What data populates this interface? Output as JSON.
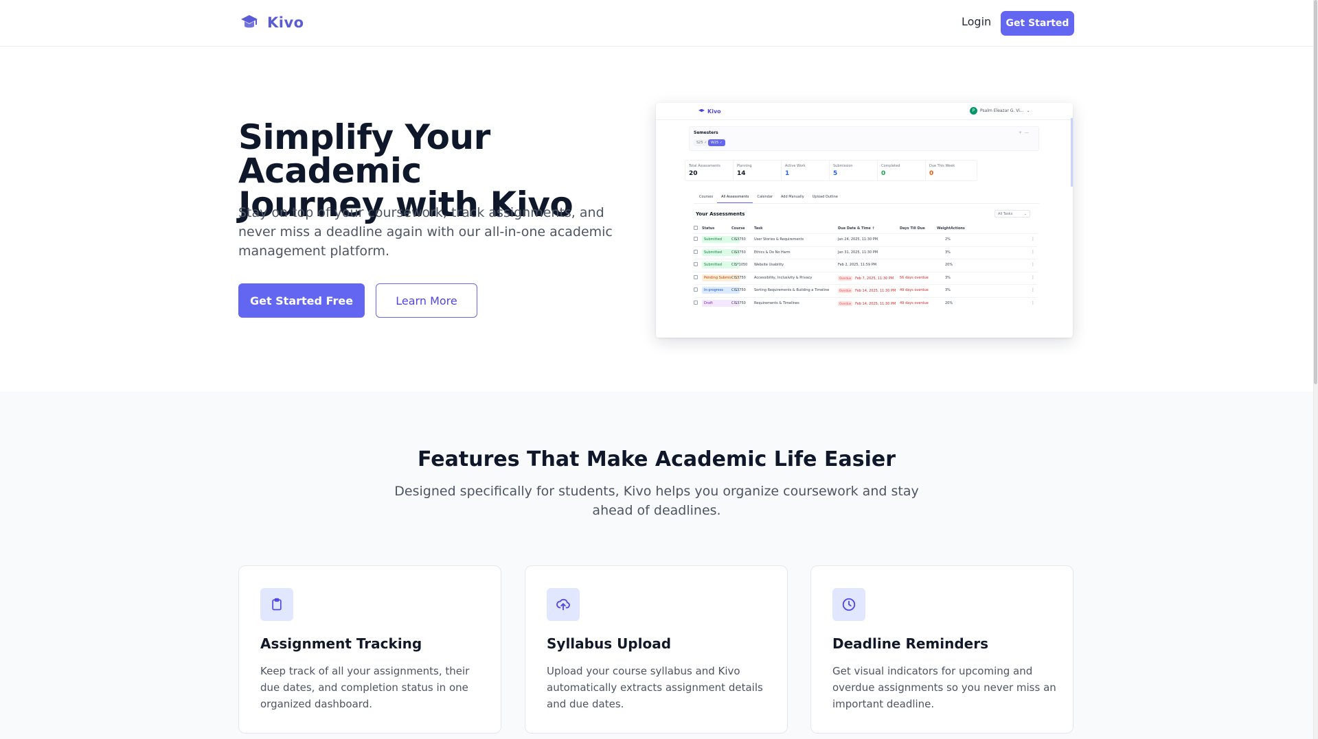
{
  "header": {
    "brand": "Kivo",
    "login": "Login",
    "cta": "Get Started"
  },
  "hero": {
    "title_line1": "Simplify Your Academic",
    "title_line2": "Journey with Kivo",
    "subtitle": "Stay on top of your coursework, track assignments, and never miss a deadline again with our all-in-one academic management platform.",
    "primary_button": "Get Started Free",
    "secondary_button": "Learn More"
  },
  "preview": {
    "brand": "Kivo",
    "user_initial": "P",
    "user_name": "Psalm Eleazar G. Vi...",
    "semesters_label": "Semesters",
    "semester_pills": [
      "S25 ✓",
      "W25 ✓"
    ],
    "stats": [
      {
        "label": "Total Assessments",
        "value": "20",
        "color": "#111827"
      },
      {
        "label": "Planning",
        "value": "14",
        "color": "#111827"
      },
      {
        "label": "Active Work",
        "value": "1",
        "color": "#2563eb"
      },
      {
        "label": "Submission",
        "value": "5",
        "color": "#2563eb"
      },
      {
        "label": "Completed",
        "value": "0",
        "color": "#16a34a"
      },
      {
        "label": "Due This Week",
        "value": "0",
        "color": "#ea580c"
      }
    ],
    "tabs": [
      "Courses",
      "All Assessments",
      "Calendar",
      "Add Manually",
      "Upload Outline"
    ],
    "panel_title": "Your Assessments",
    "filter": "All Tasks",
    "columns": [
      "Status",
      "Course",
      "Task",
      "Due Date & Time ↑",
      "Days Till Due",
      "Weight",
      "Actions"
    ],
    "rows": [
      {
        "status": "Submitted",
        "status_class": "st-submitted",
        "course": "CIS3750",
        "task": "User Stories & Requirements",
        "due": "Jan 24, 2025, 11:30 PM",
        "days": "",
        "weight": "2%",
        "overdue": false
      },
      {
        "status": "Submitted",
        "status_class": "st-submitted",
        "course": "CIS3750",
        "task": "Ethics & Do No Harm",
        "due": "Jan 31, 2025, 11:30 PM",
        "days": "",
        "weight": "3%",
        "overdue": false
      },
      {
        "status": "Submitted",
        "status_class": "st-submitted",
        "course": "CIS*1050",
        "task": "Website Usability",
        "due": "Feb 2, 2025, 11:59 PM",
        "days": "",
        "weight": "20%",
        "overdue": false
      },
      {
        "status": "Pending Submis",
        "status_class": "st-pending",
        "course": "CIS3750",
        "task": "Accessibility, Inclusivity & Privacy",
        "due": "Feb 7, 2025, 11:30 PM",
        "days": "56 days overdue",
        "weight": "3%",
        "overdue": true
      },
      {
        "status": "In-progress",
        "status_class": "st-progress",
        "course": "CIS3750",
        "task": "Sorting Requirements & Building a Timeline",
        "due": "Feb 14, 2025, 11:30 PM",
        "days": "49 days overdue",
        "weight": "3%",
        "overdue": true
      },
      {
        "status": "Draft",
        "status_class": "st-draft",
        "course": "CIS3750",
        "task": "Requirements & Timelines",
        "due": "Feb 14, 2025, 11:30 PM",
        "days": "49 days overdue",
        "weight": "20%",
        "overdue": true
      }
    ],
    "overdue_badge": "Overdue"
  },
  "features": {
    "title": "Features That Make Academic Life Easier",
    "subtitle": "Designed specifically for students, Kivo helps you organize coursework and stay ahead of deadlines.",
    "cards": [
      {
        "icon": "clipboard-icon",
        "title": "Assignment Tracking",
        "text": "Keep track of all your assignments, their due dates, and completion status in one organized dashboard."
      },
      {
        "icon": "upload-cloud-icon",
        "title": "Syllabus Upload",
        "text": "Upload your course syllabus and Kivo automatically extracts assignment details and due dates."
      },
      {
        "icon": "clock-icon",
        "title": "Deadline Reminders",
        "text": "Get visual indicators for upcoming and overdue assignments so you never miss an important deadline."
      }
    ]
  },
  "colors": {
    "primary": "#6366f1",
    "heading": "#0f172a",
    "body": "#4b5563",
    "section_bg": "#f9fafb",
    "icon_bg": "#e0e7ff"
  }
}
